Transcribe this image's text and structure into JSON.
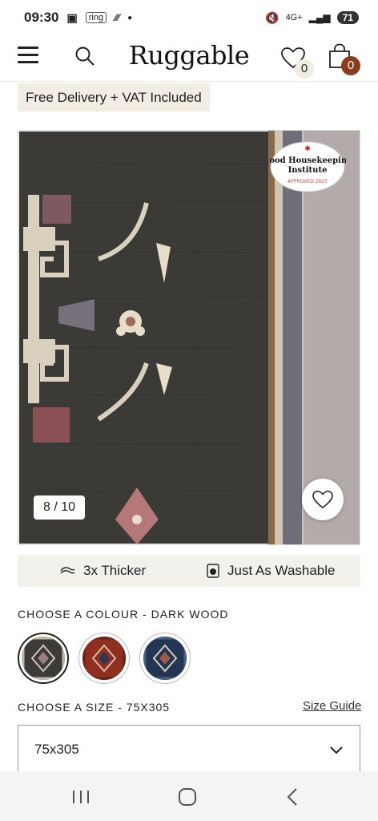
{
  "status_bar": {
    "time": "09:30",
    "ring_label": "ring",
    "network": "4G+",
    "battery": "71"
  },
  "header": {
    "logo": "Ruggable",
    "wishlist_count": "0",
    "cart_count": "0"
  },
  "promo": {
    "text": "Free Delivery + VAT Included"
  },
  "gallery": {
    "image_counter": "8 / 10",
    "seal_lines": [
      "Good Housekeeping",
      "Institute",
      "APPROVED 2025"
    ]
  },
  "features": [
    {
      "label": "3x Thicker",
      "icon": "layers-icon"
    },
    {
      "label": "Just As Washable",
      "icon": "washing-machine-icon"
    }
  ],
  "colour": {
    "label": "CHOOSE A COLOUR - DARK WOOD",
    "options": [
      {
        "name": "Dark Wood",
        "color": "#3d3b38",
        "selected": true
      },
      {
        "name": "Red",
        "color": "#8e2f22",
        "selected": false
      },
      {
        "name": "Navy",
        "color": "#223552",
        "selected": false
      }
    ]
  },
  "size": {
    "label": "CHOOSE A SIZE - 75X305",
    "guide_link": "Size Guide",
    "selected": "75x305"
  },
  "colors": {
    "accent": "#8a3d1e",
    "promo_bg": "#f1ede3",
    "rug_dark": "#3b3a37",
    "rug_cream": "#d9d0bd",
    "rug_rose": "#b37877"
  }
}
